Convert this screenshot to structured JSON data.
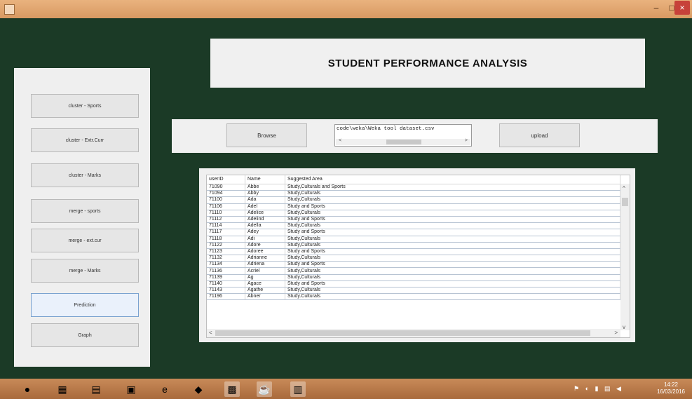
{
  "window": {
    "title": "",
    "min": "–",
    "max": "□",
    "close": "×"
  },
  "title": "STUDENT PERFORMANCE ANALYSIS",
  "sidebar": {
    "buttons": [
      "cluster - Sports",
      "cluster - Extr.Curr",
      "cluster - Marks",
      "merge - sports",
      "merge - ext.cur",
      "merge - Marks",
      "Prediction",
      "Graph"
    ]
  },
  "upload": {
    "browse_label": "Browse",
    "path_value": "code\\weka\\Weka tool dataset.csv",
    "upload_label": "upload"
  },
  "table": {
    "headers": [
      "userID",
      "Name",
      "Suggested Area"
    ],
    "rows": [
      [
        "71090",
        "Abbe",
        "Study,Culturals and Sports"
      ],
      [
        "71094",
        "Abby",
        "Study,Culturals"
      ],
      [
        "71100",
        "Ada",
        "Study,Culturals"
      ],
      [
        "71106",
        "Adel",
        "Study and Sports"
      ],
      [
        "71110",
        "Adelice",
        "Study,Culturals"
      ],
      [
        "71112",
        "Adelind",
        "Study and Sports"
      ],
      [
        "71114",
        "Adella",
        "Study,Culturals"
      ],
      [
        "71117",
        "Adey",
        "Study and Sports"
      ],
      [
        "71118",
        "Adi",
        "Study,Culturals"
      ],
      [
        "71122",
        "Adore",
        "Study,Culturals"
      ],
      [
        "71123",
        "Adoree",
        "Study and Sports"
      ],
      [
        "71132",
        "Adrianne",
        "Study,Culturals"
      ],
      [
        "71134",
        "Adriena",
        "Study and Sports"
      ],
      [
        "71136",
        "Acriel",
        "Study,Culturals"
      ],
      [
        "71139",
        "Ag",
        "Study,Culturals"
      ],
      [
        "71140",
        "Agace",
        "Study and Sports"
      ],
      [
        "71143",
        "Agathe",
        "Study,Culturals"
      ],
      [
        "71196",
        "Abner",
        "Study.Culturals"
      ]
    ]
  },
  "clock": {
    "time": "14:22",
    "date": "16/03/2016"
  }
}
